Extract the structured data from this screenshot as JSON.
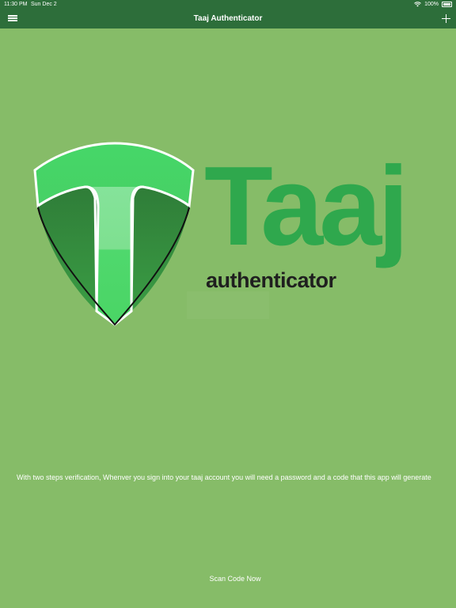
{
  "status_bar": {
    "time": "11:30 PM",
    "date": "Sun Dec 2",
    "battery": "100%"
  },
  "nav": {
    "title": "Taaj Authenticator",
    "menu_icon": "menu-icon",
    "add_icon": "plus-icon"
  },
  "logo": {
    "word": "Taaj",
    "subtitle": "authenticator",
    "colors": {
      "brand_green": "#2fa84d",
      "dark_text": "#1f1f1f",
      "shield_light": "#4dd466",
      "shield_dark": "#2f8f3f"
    }
  },
  "content": {
    "description": "With two steps verification, Whenver you sign into your taaj account you will need a password and a code that this app will generate",
    "scan_button_label": "Scan Code Now"
  },
  "theme": {
    "background": "#86bc68",
    "nav_background": "#2d6e3a"
  }
}
